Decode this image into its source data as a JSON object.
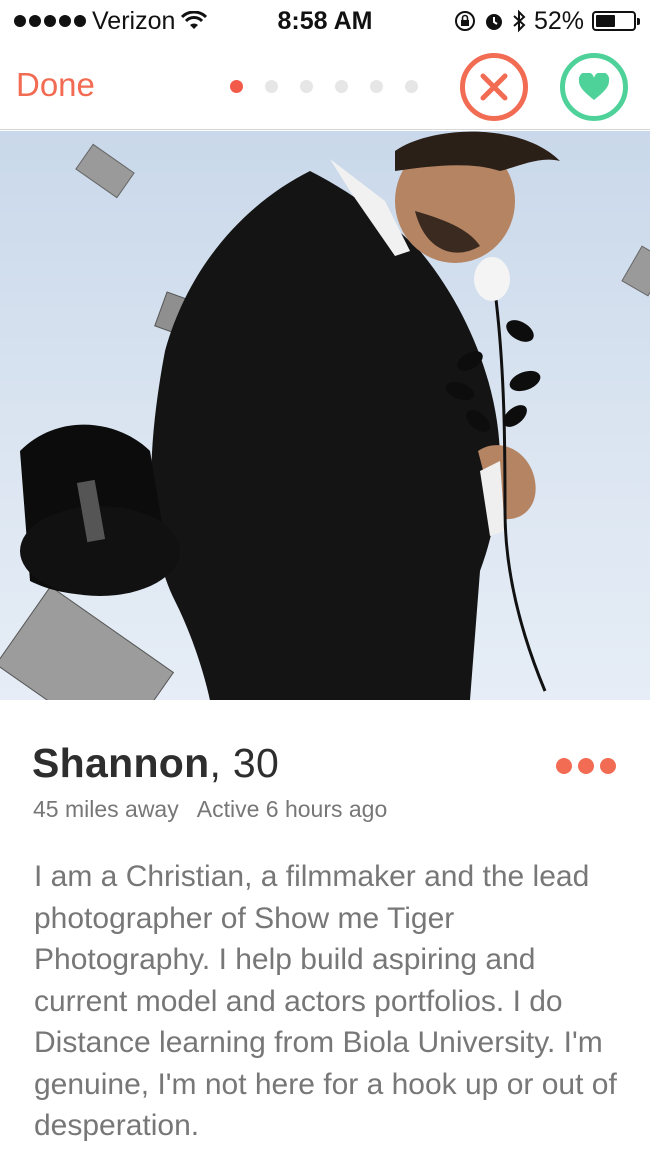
{
  "status_bar": {
    "carrier": "Verizon",
    "time": "8:58 AM",
    "battery": "52%",
    "battery_level": 0.52,
    "icons": [
      "signal-dots-icon",
      "wifi-icon",
      "orientation-lock-icon",
      "alarm-icon",
      "bluetooth-icon",
      "battery-icon"
    ]
  },
  "nav": {
    "done_label": "Done",
    "photo_count": 6,
    "active_photo_index": 0,
    "nope_icon": "close-icon",
    "like_icon": "heart-icon"
  },
  "colors": {
    "accent": "#f26b53",
    "like": "#4fd29a",
    "text_dark": "#2e2e2e",
    "text_muted": "#777777"
  },
  "profile": {
    "name": "Shannon",
    "name_separator": ", ",
    "age": "30",
    "distance": "45 miles away",
    "active": "Active 6 hours ago",
    "bio": "I am a Christian, a filmmaker and the lead photographer of Show me Tiger Photography. I help build aspiring and current model and actors portfolios. I do Distance learning from Biola University.  I'm genuine,  I'm not here for a hook up or out of desperation."
  }
}
